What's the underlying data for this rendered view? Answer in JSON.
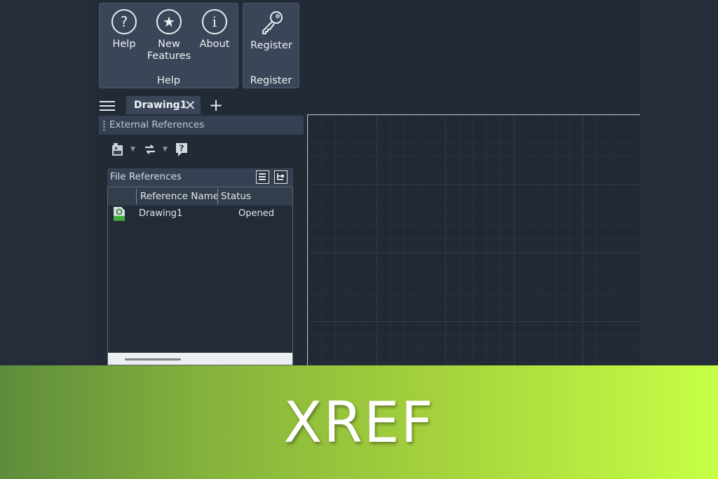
{
  "ribbon": {
    "help_group": {
      "label": "Help",
      "buttons": [
        {
          "label": "Help",
          "icon": "question-icon",
          "glyph": "?"
        },
        {
          "label": "New\nFeatures",
          "icon": "star-icon",
          "glyph": "★"
        },
        {
          "label": "About",
          "icon": "info-icon",
          "glyph": "i"
        }
      ]
    },
    "register_group": {
      "label": "Register",
      "buttons": [
        {
          "label": "Register",
          "icon": "key-icon"
        }
      ]
    }
  },
  "tabs": {
    "menu_icon": "hamburger-menu-icon",
    "active_tab": "Drawing1",
    "close_glyph": "✕",
    "add_glyph": "+"
  },
  "panel": {
    "title": "External References",
    "file_references": {
      "title": "File References",
      "columns": [
        "Reference Name",
        "Status"
      ],
      "rows": [
        {
          "name": "Drawing1",
          "status": "Opened",
          "icon": "dwg-file-icon"
        }
      ]
    }
  },
  "banner": {
    "text": "XREF",
    "gradient_start": "#5f8c3c",
    "gradient_end": "#c6ff46"
  },
  "colors": {
    "app_bg": "#222a35",
    "ribbon_group_bg": "#3a4657",
    "canvas_border": "#b8bec7"
  }
}
